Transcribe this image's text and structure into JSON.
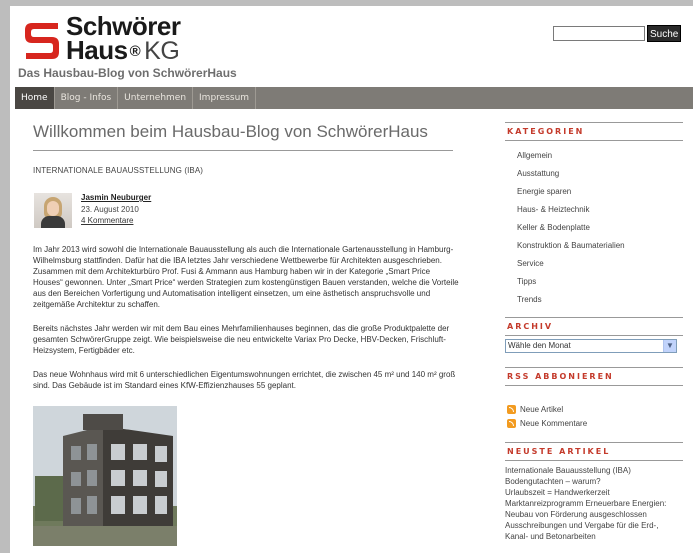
{
  "header": {
    "brand_line1": "Schwörer",
    "brand_line2": "Haus",
    "brand_reg": "®",
    "brand_kg": "KG",
    "tagline": "Das Hausbau-Blog von SchwörerHaus",
    "logo_color": "#d7261e"
  },
  "search": {
    "value": "",
    "button_label": "Suche"
  },
  "nav": {
    "items": [
      "Home",
      "Blog - Infos",
      "Unternehmen",
      "Impressum"
    ],
    "active": "Home"
  },
  "main": {
    "title": "Willkommen beim Hausbau-Blog von SchwörerHaus",
    "post": {
      "category": "INTERNATIONALE BAUAUSSTELLUNG (IBA)",
      "author": "Jasmin Neuburger",
      "date": "23. August 2010",
      "comments": "4 Kommentare",
      "paragraphs": [
        "Im Jahr 2013 wird sowohl die Internationale Bauausstellung als auch die Internationale Gartenausstellung in Hamburg-Wilhelmsburg stattfinden. Dafür hat die IBA letztes Jahr verschiedene Wettbewerbe für Architekten ausgeschrieben. Zusammen mit dem Architekturbüro Prof. Fusi & Ammann aus Hamburg haben wir in der Kategorie „Smart Price Houses“ gewonnen. Unter „Smart Price“ werden Strategien zum kostengünstigen Bauen verstanden, welche die Vorteile aus den Bereichen Vorfertigung und Automatisation intelligent einsetzen, um eine ästhetisch anspruchsvolle und zeitgemäße Architektur zu schaffen.",
        "Bereits nächstes Jahr werden wir mit dem Bau eines Mehrfamilienhauses beginnen, das die große Produktpalette der gesamten SchwörerGruppe zeigt. Wie beispielsweise die neu entwickelte Variax Pro Decke, HBV-Decken, Frischluft-Heizsystem, Fertigbäder etc.",
        "Das neue Wohnhaus wird mit 6 unterschiedlichen Eigentumswohnungen errichtet, die zwischen 45 m² und 140 m² groß sind. Das Gebäude ist im Standard eines KfW-Effizienzhauses 55 geplant."
      ]
    }
  },
  "sidebar": {
    "categories_title": "KATEGORIEN",
    "categories": [
      "Allgemein",
      "Ausstattung",
      "Energie sparen",
      "Haus- & Heiztechnik",
      "Keller & Bodenplatte",
      "Konstruktion & Baumaterialien",
      "Service",
      "Tipps",
      "Trends"
    ],
    "archive_title": "ARCHIV",
    "archive_select": "Wähle den Monat",
    "rss_title": "RSS ABBONIEREN",
    "rss_items": [
      "Neue Artikel",
      "Neue Kommentare"
    ],
    "news_title": "NEUSTE ARTIKEL",
    "news": [
      "Internationale Bauausstellung (IBA)",
      "Bodengutachten – warum?",
      "Urlaubszeit = Handwerkerzeit",
      "Marktanreizprogramm Erneuerbare Energien: Neubau von Förderung ausgeschlossen",
      "Ausschreibungen und Vergabe für die Erd-, Kanal- und Betonarbeiten"
    ]
  },
  "colors": {
    "accent": "#c43a2b",
    "nav_bg": "#7e7b76",
    "nav_active": "#4a4743"
  }
}
